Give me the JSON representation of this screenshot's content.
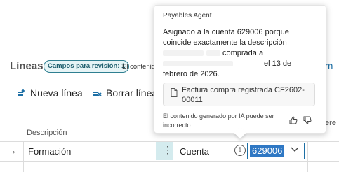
{
  "lines": {
    "title": "Líneas",
    "badge": "Campos para revisión: 1",
    "cut_text": "El contenido",
    "right_partial": "dm"
  },
  "toolbar": {
    "new_line": "Nueva línea",
    "delete_line": "Borrar línea"
  },
  "grid": {
    "header_description": "Descripción",
    "header_right_partial": "fere",
    "row": {
      "description": "Formación",
      "type": "Cuenta",
      "account": "629006"
    }
  },
  "popover": {
    "title": "Payables Agent",
    "line1": "Asignado a la cuenta 629006 porque",
    "line2": "coincide exactamente la descripción",
    "line3": "comprada a",
    "line4": "el 13 de",
    "line5": "febrero de 2026.",
    "document": "Factura compra registrada CF2602-00011",
    "footer": "El contenido generado por IA puede ser incorrecto"
  },
  "colors": {
    "accent": "#2f78c4",
    "badge_border": "#2f7f91",
    "selection_cell": "#d4ebee"
  },
  "icons": [
    "new-line-icon",
    "delete-line-icon",
    "row-arrow-icon",
    "info-icon",
    "chevron-down-icon",
    "document-icon",
    "thumbs-up-icon",
    "thumbs-down-icon"
  ]
}
